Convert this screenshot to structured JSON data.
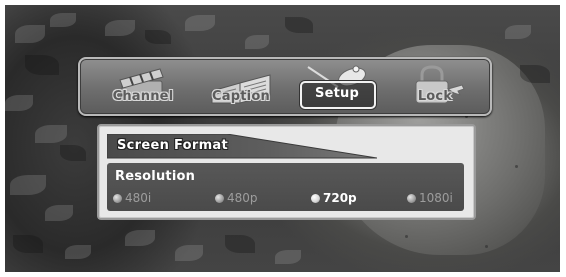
{
  "menu": {
    "items": [
      {
        "label": "Channel",
        "icon": "clapperboard-icon"
      },
      {
        "label": "Caption",
        "icon": "open-book-icon"
      },
      {
        "label": "Setup",
        "icon": "satellite-dish-icon",
        "selected": true
      },
      {
        "label": "Lock",
        "icon": "padlock-icon"
      }
    ]
  },
  "panel": {
    "title": "Screen  Format",
    "setting": {
      "label": "Resolution",
      "options": [
        {
          "label": "480i",
          "selected": false
        },
        {
          "label": "480p",
          "selected": false
        },
        {
          "label": "720p",
          "selected": true
        },
        {
          "label": "1080i",
          "selected": false
        }
      ]
    }
  },
  "colors": {
    "panel_bg": "#e8e8e8",
    "row_bg": "#4f4f4f",
    "selected_text": "#ffffff",
    "unselected_text": "#9d9d9d"
  }
}
